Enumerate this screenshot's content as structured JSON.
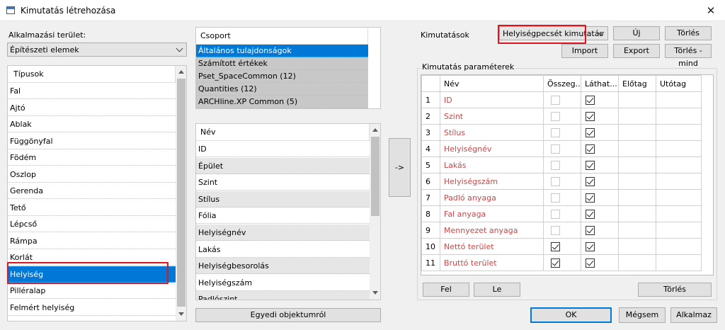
{
  "window": {
    "title": "Kimutatás létrehozása",
    "close_symbol": "✕"
  },
  "left": {
    "area_label": "Alkalmazási terület:",
    "area_value": "Építészeti elemek",
    "types_header": "Típusok",
    "types": [
      "Fal",
      "Ajtó",
      "Ablak",
      "Függönyfal",
      "Födém",
      "Oszlop",
      "Gerenda",
      "Tető",
      "Lépcső",
      "Rámpa",
      "Korlát",
      "Helyiség",
      "Pilléralap",
      "Felmért helyiség"
    ],
    "selected_type": "Helyiség"
  },
  "middle": {
    "group_header": "Csoport",
    "groups": [
      "Általános tulajdonságok",
      "Számított értékek",
      "Pset_SpaceCommon (12)",
      "Quantities (12)",
      "ARCHline.XP Common (5)"
    ],
    "name_header": "Név",
    "names": [
      "ID",
      "Épület",
      "Szint",
      "Stílus",
      "Fólia",
      "Helyiségnév",
      "Lakás",
      "Helyiségbesorolás",
      "Helyiségszám",
      "Padlószint"
    ],
    "custom_button": "Egyedi objektumról",
    "arrow_button": "->"
  },
  "right": {
    "reports_label": "Kimutatások",
    "report_value": "Helyiségpecsét kimutatás",
    "new_button": "Új",
    "delete_button": "Törlés",
    "import_button": "Import",
    "export_button": "Export",
    "delete_all_button": "Törlés - mind",
    "params_label": "Kimutatás paraméterek",
    "columns": [
      "Név",
      "Összeg...",
      "Láthat...",
      "Előtag",
      "Utótag"
    ],
    "rows": [
      {
        "num": "1",
        "name": "ID",
        "sum": false,
        "vis": true
      },
      {
        "num": "2",
        "name": "Szint",
        "sum": false,
        "vis": true
      },
      {
        "num": "3",
        "name": "Stílus",
        "sum": false,
        "vis": true
      },
      {
        "num": "4",
        "name": "Helyiségnév",
        "sum": false,
        "vis": true
      },
      {
        "num": "5",
        "name": "Lakás",
        "sum": false,
        "vis": true
      },
      {
        "num": "6",
        "name": "Helyiségszám",
        "sum": false,
        "vis": true
      },
      {
        "num": "7",
        "name": "Padló anyaga",
        "sum": false,
        "vis": true
      },
      {
        "num": "8",
        "name": "Fal anyaga",
        "sum": false,
        "vis": true
      },
      {
        "num": "9",
        "name": "Mennyezet anyaga",
        "sum": false,
        "vis": true
      },
      {
        "num": "10",
        "name": "Nettó terület",
        "sum": true,
        "vis": true
      },
      {
        "num": "11",
        "name": "Bruttó terület",
        "sum": true,
        "vis": true
      }
    ],
    "up_button": "Fel",
    "down_button": "Le",
    "row_delete_button": "Törlés"
  },
  "footer": {
    "ok": "OK",
    "cancel": "Mégsem",
    "apply": "Alkalmaz"
  },
  "colors": {
    "selection": "#0078d7",
    "highlight_box": "#e0141e",
    "param_text": "#c74848"
  }
}
